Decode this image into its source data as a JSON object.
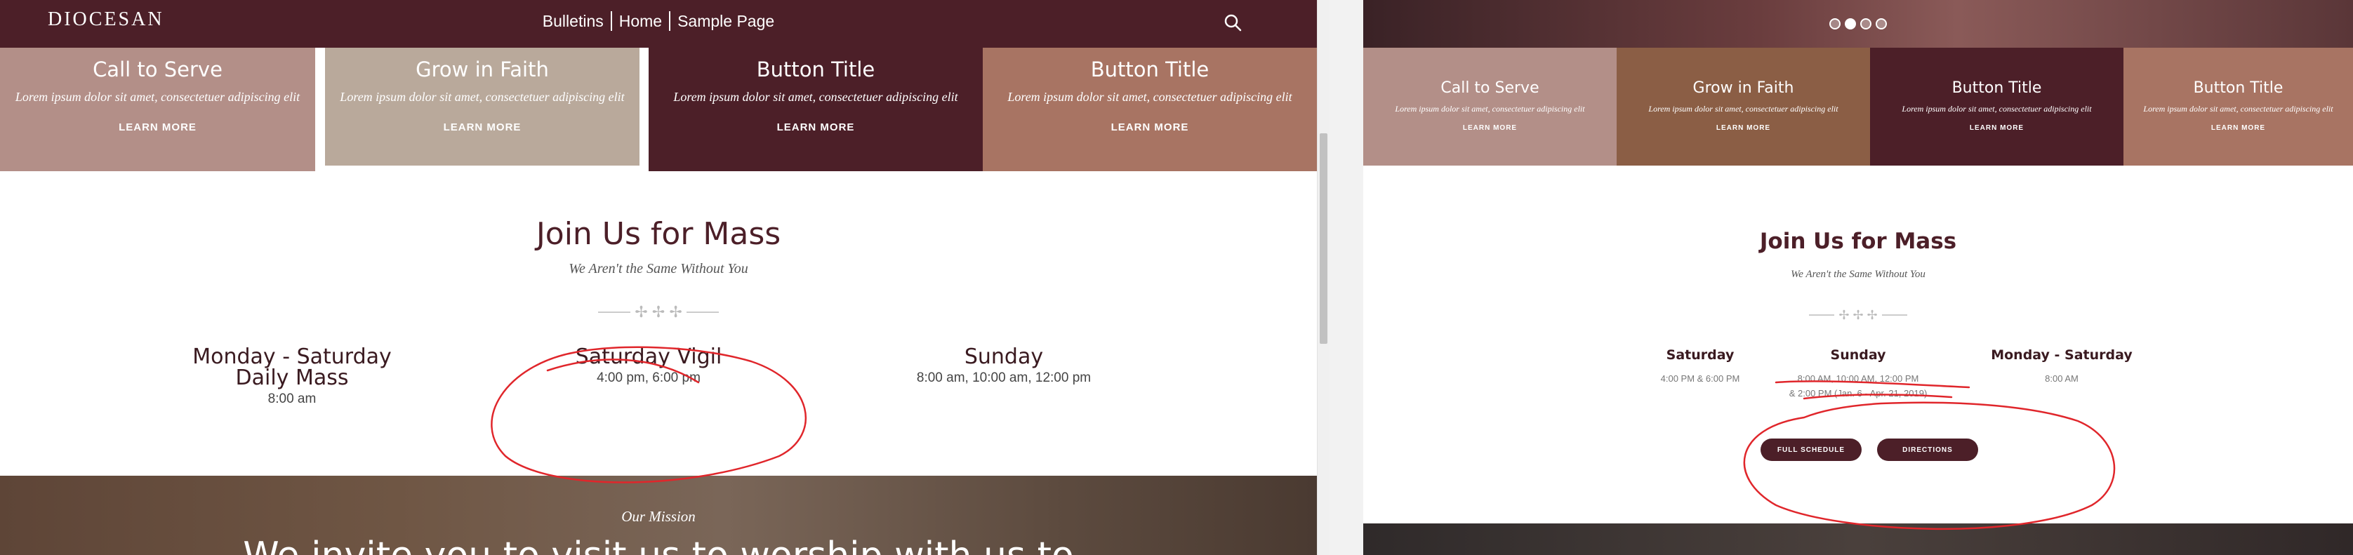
{
  "left": {
    "header": {
      "logo": "DIOCESAN",
      "nav": [
        "Bulletins",
        "Home",
        "Sample Page"
      ],
      "search_icon": "search-icon",
      "bg_color": "#4c1f28"
    },
    "tiles": [
      {
        "title": "Call to Serve",
        "text": "Lorem ipsum dolor sit amet, consectetuer adipiscing elit",
        "link": "LEARN MORE",
        "color": "#b38f88"
      },
      {
        "title": "Grow in Faith",
        "text": "Lorem ipsum dolor sit amet, consectetuer adipiscing elit",
        "link": "LEARN MORE",
        "color": "#b9a99b"
      },
      {
        "title": "Button Title",
        "text": "Lorem ipsum dolor sit amet, consectetuer adipiscing elit",
        "link": "LEARN MORE",
        "color": "#4c1f28"
      },
      {
        "title": "Button Title",
        "text": "Lorem ipsum dolor sit amet, consectetuer adipiscing elit",
        "link": "LEARN MORE",
        "color": "#a87463"
      }
    ],
    "mass": {
      "title": "Join Us for Mass",
      "subtitle": "We Aren't the Same Without You",
      "columns": [
        {
          "title_line1": "Monday - Saturday",
          "title_line2": "Daily Mass",
          "times": "8:00 am"
        },
        {
          "title_line1": "Saturday Vigil",
          "title_line2": "",
          "times": "4:00 pm, 6:00 pm"
        },
        {
          "title_line1": "Sunday",
          "title_line2": "",
          "times": "8:00 am, 10:00 am, 12:00 pm"
        }
      ]
    },
    "hero": {
      "eyebrow": "Our Mission",
      "heading": "We invite you to visit us to worship with us to"
    }
  },
  "right": {
    "slider_dots": 4,
    "slider_active": 2,
    "tiles": [
      {
        "title": "Call to Serve",
        "text": "Lorem ipsum dolor sit amet, consectetuer adipiscing elit",
        "link": "LEARN MORE",
        "color": "#b38f88"
      },
      {
        "title": "Grow in Faith",
        "text": "Lorem ipsum dolor sit amet, consectetuer adipiscing elit",
        "link": "LEARN MORE",
        "color": "#8b5e45"
      },
      {
        "title": "Button Title",
        "text": "Lorem ipsum dolor sit amet, consectetuer adipiscing elit",
        "link": "LEARN MORE",
        "color": "#4c1f28"
      },
      {
        "title": "Button Title",
        "text": "Lorem ipsum dolor sit amet, consectetuer adipiscing elit",
        "link": "LEARN MORE",
        "color": "#a87463"
      }
    ],
    "mass": {
      "title": "Join Us for Mass",
      "subtitle": "We Aren't the Same Without You",
      "columns": [
        {
          "title": "Saturday",
          "times": [
            "4:00 PM & 6:00 PM"
          ]
        },
        {
          "title": "Sunday",
          "times": [
            "8:00 AM, 10:00 AM, 12:00 PM",
            "& 2:00 PM (Jan. 6 - Apr. 21, 2019)"
          ]
        },
        {
          "title": "Monday - Saturday",
          "times": [
            "8:00 AM"
          ]
        }
      ],
      "buttons": {
        "full_schedule": "FULL SCHEDULE",
        "directions": "DIRECTIONS"
      }
    }
  },
  "annotation_color": "#e0262b"
}
